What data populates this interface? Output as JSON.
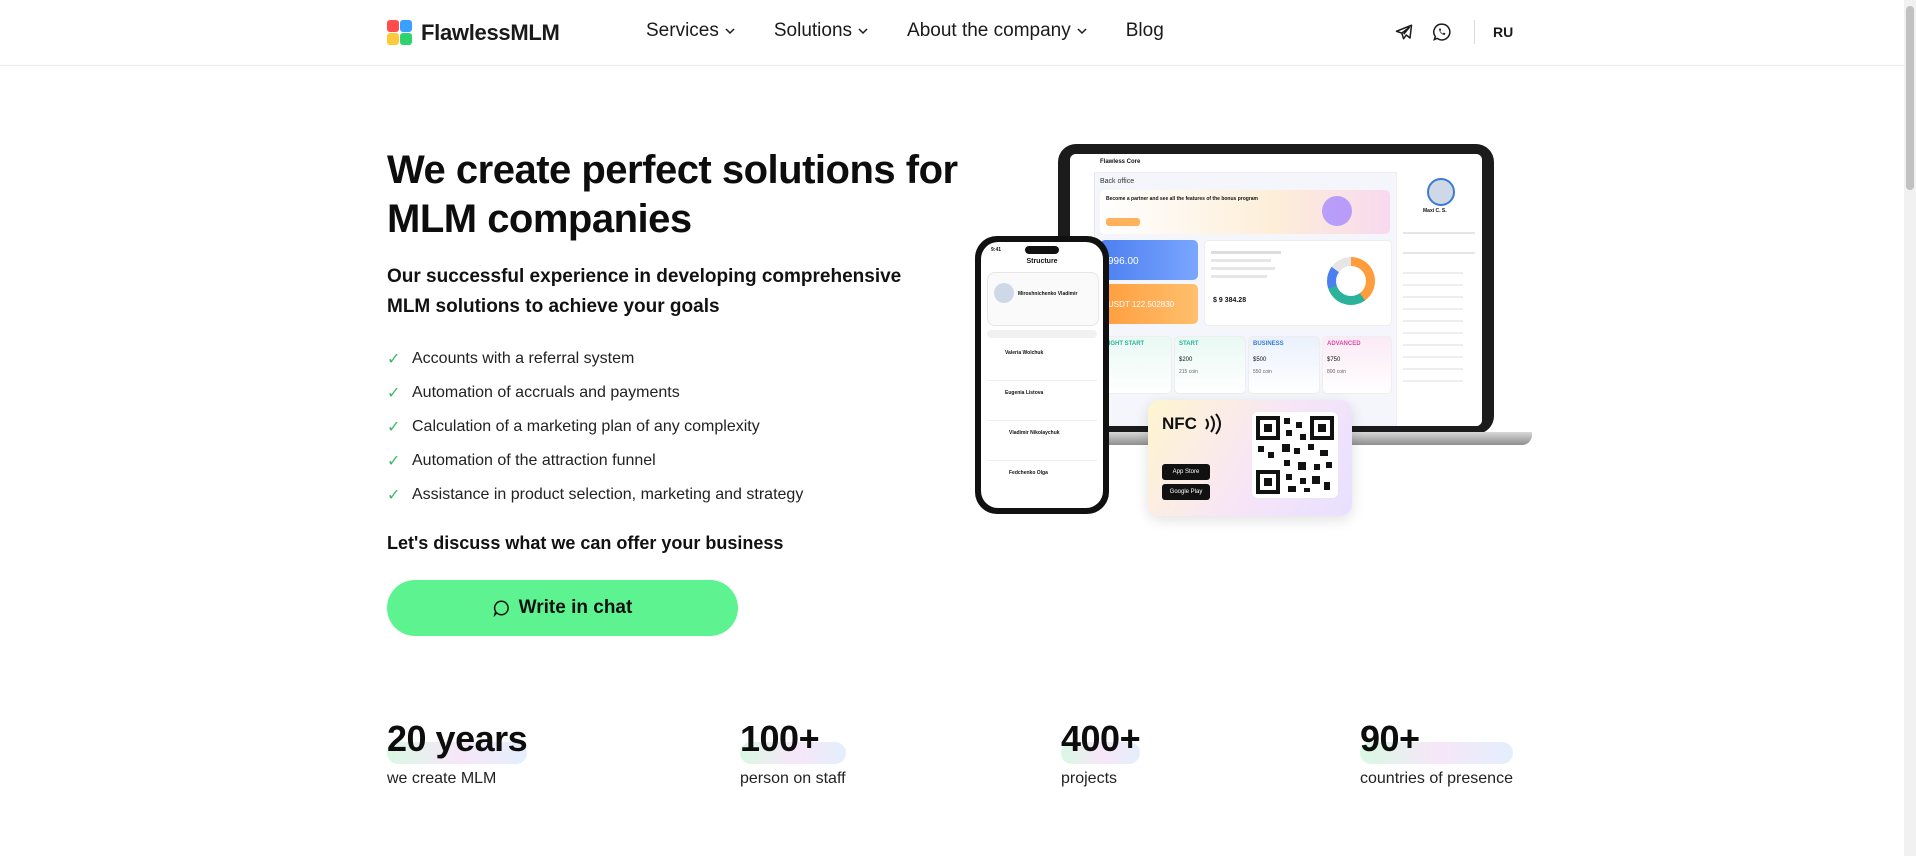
{
  "brand": {
    "name": "FlawlessMLM"
  },
  "nav": [
    {
      "label": "Services",
      "has_dropdown": true
    },
    {
      "label": "Solutions",
      "has_dropdown": true
    },
    {
      "label": "About the company",
      "has_dropdown": true
    },
    {
      "label": "Blog",
      "has_dropdown": false
    }
  ],
  "header": {
    "icons": [
      "telegram-icon",
      "whatsapp-icon"
    ],
    "language": "RU"
  },
  "hero": {
    "title": "We create perfect solutions for MLM companies",
    "subtitle": "Our successful experience in developing comprehensive MLM solutions to achieve your goals",
    "features": [
      "Accounts with a referral system",
      "Automation of accruals and payments",
      "Calculation of a marketing plan of any complexity",
      "Automation of the attraction funnel",
      "Assistance in product selection, marketing and strategy"
    ],
    "cta_text": "Let's discuss what we can offer your business",
    "cta_button": "Write in chat"
  },
  "stats": [
    {
      "value": "20 years",
      "label": "we create MLM"
    },
    {
      "value": "100+",
      "label": "person on staff"
    },
    {
      "value": "400+",
      "label": "projects"
    },
    {
      "value": "90+",
      "label": "countries of presence"
    }
  ],
  "illustration": {
    "laptop": {
      "app_name": "Flawless Core",
      "section": "Back office",
      "banner": "Become a partner and see all the features of the bonus program",
      "balance_1": "996.00",
      "balance_2": "USDT 122.502830",
      "total": "$ 9 384.28",
      "profile_name": "Maxi C. S.",
      "plans": [
        {
          "name": "START",
          "price": "$200",
          "coins": "215 coin",
          "color": "#2ab39a"
        },
        {
          "name": "BUSINESS",
          "price": "$500",
          "coins": "550 coin",
          "color": "#3a7bd5"
        },
        {
          "name": "ADVANCED",
          "price": "$750",
          "coins": "800 coin",
          "color": "#d94aa7"
        }
      ]
    },
    "phone": {
      "time": "9:41",
      "title": "Structure",
      "user": "Miroshnichenko Vladimir",
      "members": [
        "Valeria Wolchuk",
        "Eugenia Listova",
        "Vladimir Nikolaychuk",
        "Fedchenko Olga"
      ]
    },
    "nfc": {
      "label": "NFC",
      "store_1": "App Store",
      "store_2": "Google Play"
    }
  },
  "colors": {
    "accent": "#5ef391",
    "check": "#3db96a",
    "text": "#111111"
  }
}
